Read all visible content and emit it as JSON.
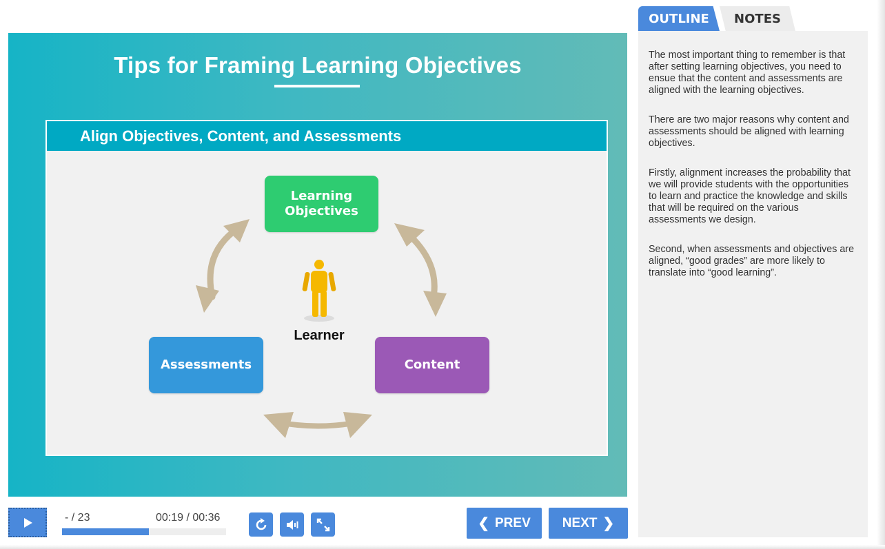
{
  "slide": {
    "title": "Tips for Framing Learning Objectives",
    "panel_header": "Align Objectives, Content, and Assessments",
    "diagram": {
      "objectives_label_line1": "Learning",
      "objectives_label_line2": "Objectives",
      "assessments_label": "Assessments",
      "content_label": "Content",
      "learner_label": "Learner"
    }
  },
  "player": {
    "slide_counter": "- / 23",
    "time": "00:19 / 00:36",
    "progress": 0.53,
    "prev_label": "PREV",
    "next_label": "NEXT"
  },
  "sidebar": {
    "tabs": [
      {
        "label": "OUTLINE",
        "active": true
      },
      {
        "label": "NOTES",
        "active": false
      }
    ],
    "notes": [
      "The most important thing to remember is that after setting learning objectives, you need to ensue that the content and assessments are aligned with the learning objectives.",
      "There are two major reasons why content and assessments should be aligned with learning objectives.",
      "Firstly, alignment increases the probability that we will provide students with the opportunities to learn and practice the knowledge and skills that will be required on the various assessments we design.",
      "Second, when assessments and objectives are aligned, “good grades” are more likely to translate into “good learning”."
    ]
  },
  "colors": {
    "accent": "#4a89dc",
    "objectives": "#2ecc71",
    "assessments": "#3498db",
    "content": "#9b59b6",
    "arrow": "#c8b89a",
    "learner": "#f5b800"
  },
  "icons": {
    "play": "play-icon",
    "replay": "replay-icon",
    "volume": "volume-icon",
    "fullscreen": "fullscreen-icon",
    "prev": "chevron-left-icon",
    "next": "chevron-right-icon"
  }
}
